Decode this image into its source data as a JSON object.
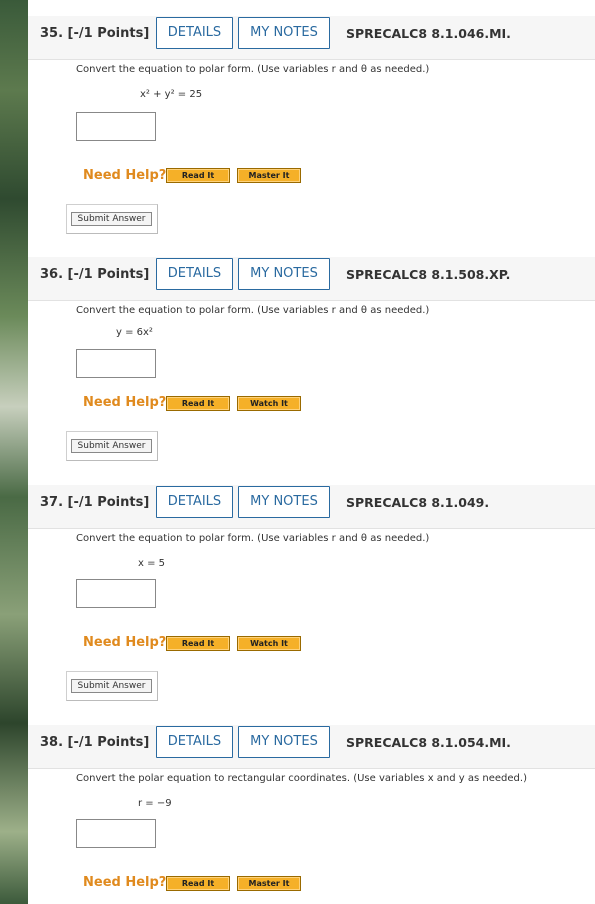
{
  "questions": [
    {
      "number": "35. [-/1 Points]",
      "details_label": "DETAILS",
      "notes_label": "MY NOTES",
      "code": "SPRECALC8 8.1.046.MI.",
      "prompt": "Convert the equation to polar form. (Use variables r and θ as needed.)",
      "equation": "x² + y² = 25",
      "need_help": "Need Help?",
      "help_buttons": [
        "Read It",
        "Master It"
      ],
      "submit_label": "Submit Answer"
    },
    {
      "number": "36. [-/1 Points]",
      "details_label": "DETAILS",
      "notes_label": "MY NOTES",
      "code": "SPRECALC8 8.1.508.XP.",
      "prompt": "Convert the equation to polar form. (Use variables r and θ as needed.)",
      "equation": "y = 6x²",
      "need_help": "Need Help?",
      "help_buttons": [
        "Read It",
        "Watch It"
      ],
      "submit_label": "Submit Answer"
    },
    {
      "number": "37. [-/1 Points]",
      "details_label": "DETAILS",
      "notes_label": "MY NOTES",
      "code": "SPRECALC8 8.1.049.",
      "prompt": "Convert the equation to polar form. (Use variables r and θ as needed.)",
      "equation": "x = 5",
      "need_help": "Need Help?",
      "help_buttons": [
        "Read It",
        "Watch It"
      ],
      "submit_label": "Submit Answer"
    },
    {
      "number": "38. [-/1 Points]",
      "details_label": "DETAILS",
      "notes_label": "MY NOTES",
      "code": "SPRECALC8 8.1.054.MI.",
      "prompt": "Convert the polar equation to rectangular coordinates. (Use variables x and y as needed.)",
      "equation": "r = −9",
      "need_help": "Need Help?",
      "help_buttons": [
        "Read It",
        "Master It"
      ]
    }
  ]
}
